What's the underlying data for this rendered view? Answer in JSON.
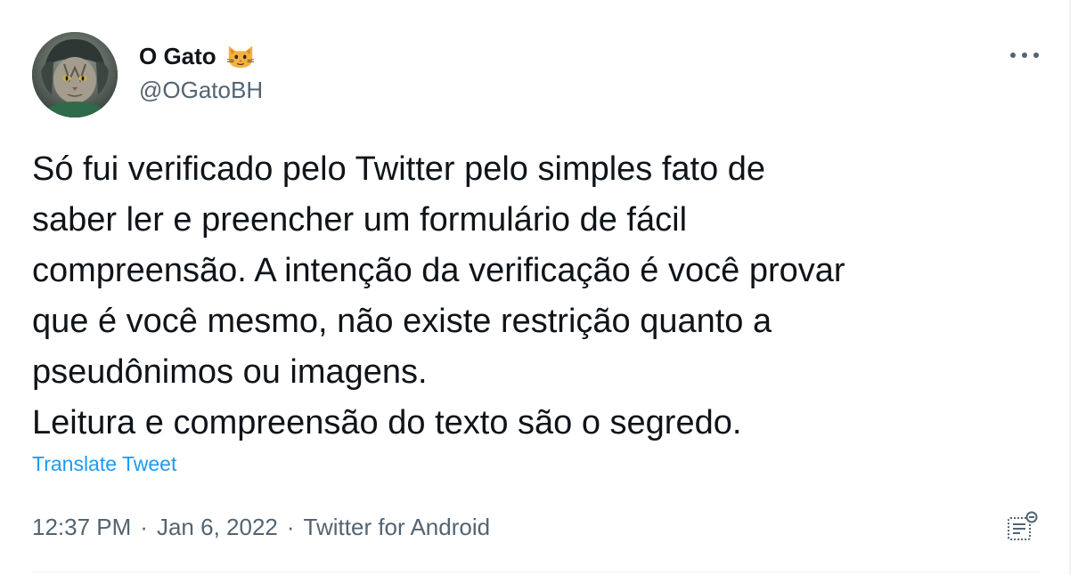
{
  "author": {
    "display_name": "O Gato",
    "handle": "@OGatoBH",
    "emoji_icon": "cat-face-emoji"
  },
  "tweet": {
    "text": "Só fui verificado pelo Twitter pelo simples fato de\nsaber ler e preencher um formulário de fácil\ncompreensão. A intenção da verificação é você provar\nque é você mesmo, não existe restrição quanto a\npseudônimos ou imagens.\nLeitura e compreensão do texto são o segredo.",
    "translate_label": "Translate Tweet"
  },
  "meta": {
    "time": "12:37 PM",
    "separator": "·",
    "date": "Jan 6, 2022",
    "source": "Twitter for Android"
  },
  "colors": {
    "link": "#1d9bf0",
    "secondary_text": "#536471",
    "primary_text": "#0f1419"
  }
}
